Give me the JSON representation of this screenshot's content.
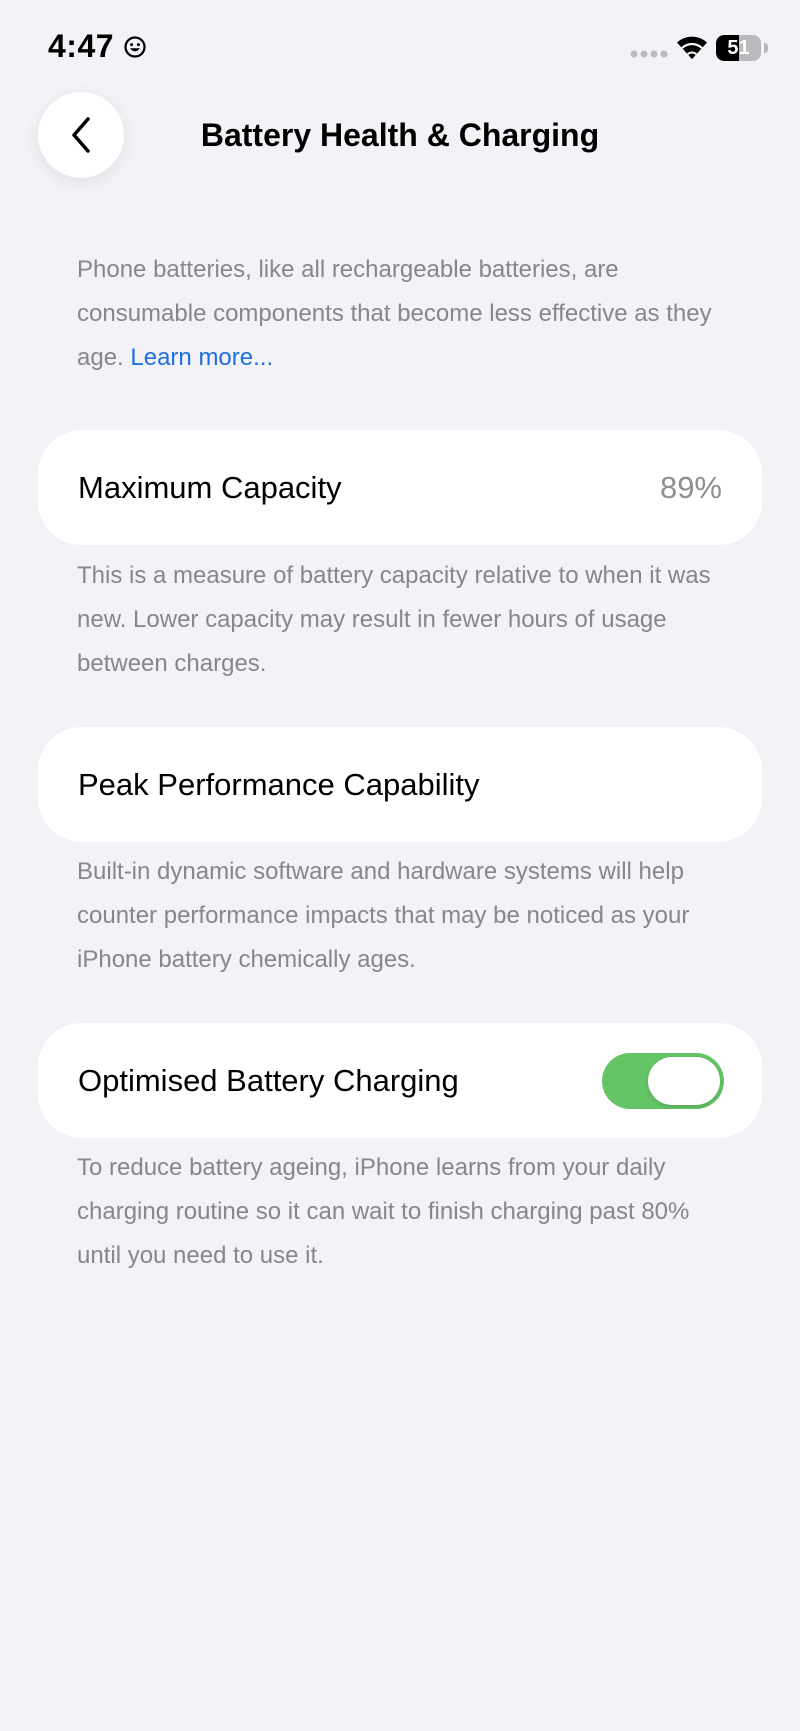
{
  "status_bar": {
    "time": "4:47",
    "battery_level": "51",
    "battery_fraction": 0.51
  },
  "icons": {
    "status_emoji": "smiley-face-icon",
    "signal": "cellular-signal-icon",
    "wifi": "wifi-icon",
    "battery": "battery-icon",
    "back": "chevron-left-icon"
  },
  "header": {
    "title": "Battery Health & Charging"
  },
  "intro": {
    "text": "Phone batteries, like all rechargeable batteries, are consumable components that become less effective as they age.",
    "link_label": "Learn more..."
  },
  "maximum_capacity": {
    "label": "Maximum Capacity",
    "value": "89%",
    "description": "This is a measure of battery capacity relative to when it was new. Lower capacity may result in fewer hours of usage between charges."
  },
  "peak_performance": {
    "label": "Peak Performance Capability",
    "description": "Built-in dynamic software and hardware systems will help counter performance impacts that may be noticed as your iPhone battery chemically ages."
  },
  "optimised_charging": {
    "label": "Optimised Battery Charging",
    "enabled": true,
    "description": "To reduce battery ageing, iPhone learns from your daily charging routine so it can wait to finish charging past 80% until you need to use it."
  },
  "colors": {
    "background": "#f2f2f7",
    "card": "#ffffff",
    "secondary_text": "#86868b",
    "link": "#1e6fe0",
    "toggle_on": "#65c466"
  }
}
